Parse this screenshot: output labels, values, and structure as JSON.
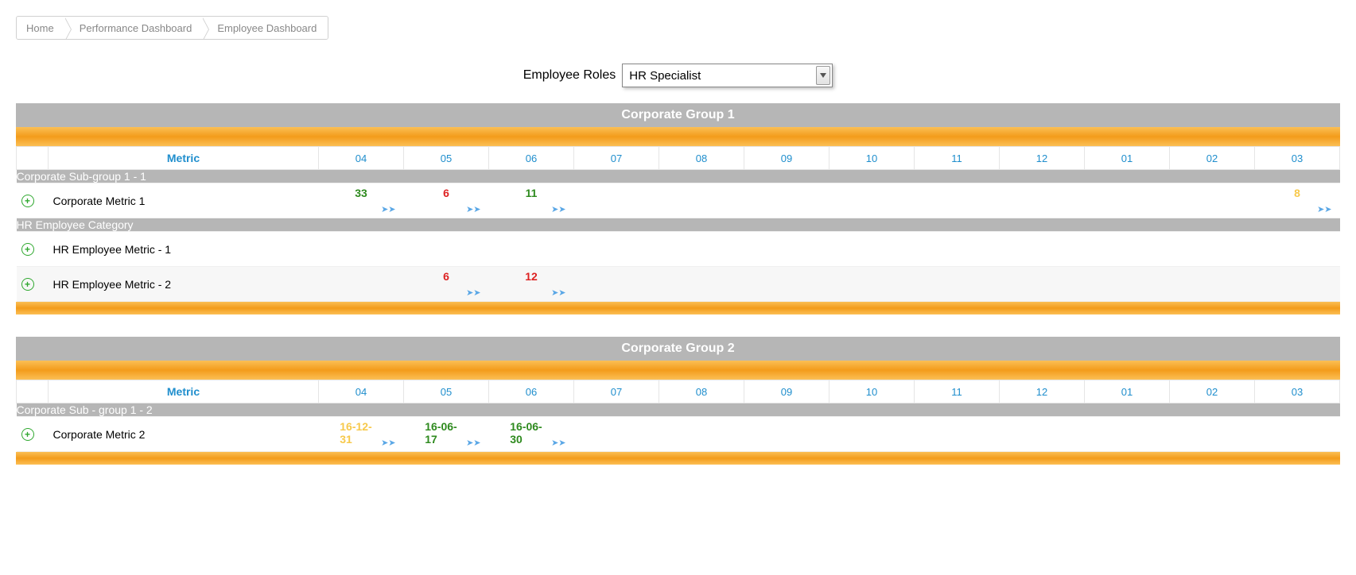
{
  "breadcrumb": [
    "Home",
    "Performance Dashboard",
    "Employee Dashboard"
  ],
  "role_label": "Employee Roles",
  "role_value": "HR Specialist",
  "columns_label": "Metric",
  "months": [
    "04",
    "05",
    "06",
    "07",
    "08",
    "09",
    "10",
    "11",
    "12",
    "01",
    "02",
    "03"
  ],
  "colors": {
    "green": "#2e8a1e",
    "red": "#d22",
    "yellow": "#f7c94b",
    "link": "#1f8ecd"
  },
  "groups": [
    {
      "title": "Corporate Group 1",
      "subgroups": [
        {
          "title": "Corporate Sub-group 1 - 1",
          "metrics": [
            {
              "name": "Corporate Metric 1",
              "values": [
                {
                  "col": "04",
                  "v": "33",
                  "c": "green",
                  "arrow": true
                },
                {
                  "col": "05",
                  "v": "6",
                  "c": "red",
                  "arrow": true
                },
                {
                  "col": "06",
                  "v": "11",
                  "c": "green",
                  "arrow": true
                },
                {
                  "col": "03",
                  "v": "8",
                  "c": "yellow",
                  "arrow": true
                }
              ]
            }
          ]
        },
        {
          "title": "HR Employee Category",
          "metrics": [
            {
              "name": "HR Employee Metric - 1",
              "values": []
            },
            {
              "name": "HR Employee Metric - 2",
              "values": [
                {
                  "col": "05",
                  "v": "6",
                  "c": "red",
                  "arrow": true
                },
                {
                  "col": "06",
                  "v": "12",
                  "c": "red",
                  "arrow": true
                }
              ]
            }
          ]
        }
      ]
    },
    {
      "title": "Corporate Group 2",
      "subgroups": [
        {
          "title": "Corporate Sub - group 1 - 2",
          "metrics": [
            {
              "name": "Corporate Metric 2",
              "values": [
                {
                  "col": "04",
                  "v": "16-12-31",
                  "c": "yellow",
                  "arrow": true
                },
                {
                  "col": "05",
                  "v": "16-06-17",
                  "c": "green",
                  "arrow": true
                },
                {
                  "col": "06",
                  "v": "16-06-30",
                  "c": "green",
                  "arrow": true
                }
              ]
            }
          ]
        }
      ]
    }
  ]
}
